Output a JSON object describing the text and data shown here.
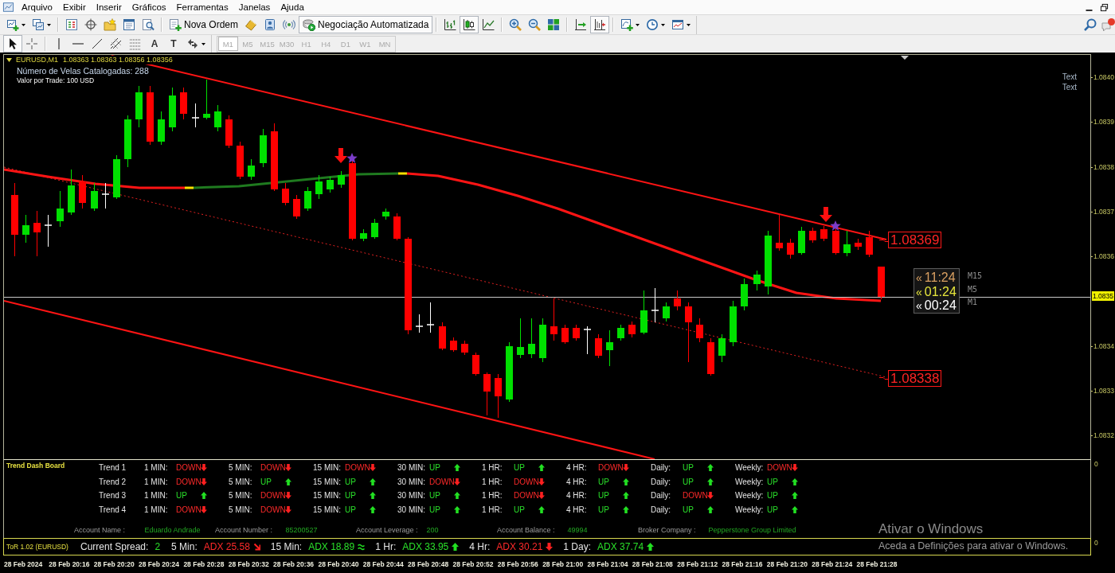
{
  "menu_bar": {
    "items": [
      "Arquivo",
      "Exibir",
      "Inserir",
      "Gráficos",
      "Ferramentas",
      "Janelas",
      "Ajuda"
    ]
  },
  "toolbar": {
    "new_order": "Nova Ordem",
    "auto_trading": {
      "label": "Negociação Automatizada",
      "on": true
    },
    "chart_types": [
      {
        "selected": false
      },
      {
        "selected": true
      },
      {
        "selected": false
      }
    ],
    "chart_shift": {
      "on": true
    }
  },
  "drawing_tools": [
    {
      "selected": true
    },
    {
      "selected": false
    },
    {
      "selected": false
    },
    {
      "selected": false
    },
    {
      "selected": false
    },
    {
      "selected": false
    },
    {
      "selected": false
    },
    {
      "selected": false,
      "glyph": "A"
    },
    {
      "selected": false,
      "glyph": "T"
    }
  ],
  "timeframes": [
    {
      "label": "M1",
      "selected": true,
      "disabled": true
    },
    {
      "label": "M5",
      "selected": false,
      "disabled": true
    },
    {
      "label": "M15",
      "selected": false,
      "disabled": true
    },
    {
      "label": "M30",
      "selected": false,
      "disabled": true
    },
    {
      "label": "H1",
      "selected": false,
      "disabled": true
    },
    {
      "label": "H4",
      "selected": false,
      "disabled": true
    },
    {
      "label": "D1",
      "selected": false,
      "disabled": true
    },
    {
      "label": "W1",
      "selected": false,
      "disabled": true
    },
    {
      "label": "MN",
      "selected": false,
      "disabled": true
    }
  ],
  "chart": {
    "symbol": "EURUSD,M1",
    "ohlc": "1.08363 1.08363 1.08356 1.08356",
    "info": [
      "Número de Velas Catalogadas: 288",
      "Valor por Trade: 100 USD"
    ],
    "corner_texts": [
      "Text",
      "Text"
    ],
    "channel_labels": [
      "1.08369",
      "1.08338"
    ],
    "timers": [
      {
        "prefix": "«",
        "value": "11:24",
        "period": "M15",
        "color": "#d9a062"
      },
      {
        "prefix": "«",
        "value": "01:24",
        "period": "M5",
        "color": "#e6e63c"
      },
      {
        "prefix": "«",
        "value": "00:24",
        "period": "M1",
        "color": "#ffffff"
      }
    ],
    "price_axis": [
      "1.0840",
      "1.0839",
      "1.0838",
      "1.0837",
      "1.0836",
      "1.0834",
      "1.0833",
      "1.0832"
    ],
    "current_price": "1.0835"
  },
  "trend_dashboard": {
    "title": "Trend Dash Board",
    "rows": [
      {
        "label": "Trend 1",
        "cells": [
          {
            "timeframe": "1 MIN:",
            "value": "DOWN",
            "kind": "down"
          },
          {
            "timeframe": "5 MIN:",
            "value": "DOWN",
            "kind": "down"
          },
          {
            "timeframe": "15 MIN:",
            "value": "DOWN",
            "kind": "down"
          },
          {
            "timeframe": "30 MIN:",
            "value": "UP",
            "kind": "up"
          },
          {
            "timeframe": "1 HR:",
            "value": "UP",
            "kind": "up"
          },
          {
            "timeframe": "4 HR:",
            "value": "DOWN",
            "kind": "down"
          },
          {
            "timeframe": "Daily:",
            "value": "UP",
            "kind": "up"
          },
          {
            "timeframe": "Weekly:",
            "value": "DOWN",
            "kind": "down"
          }
        ]
      },
      {
        "label": "Trend 2",
        "cells": [
          {
            "timeframe": "1 MIN:",
            "value": "DOWN",
            "kind": "down"
          },
          {
            "timeframe": "5 MIN:",
            "value": "UP",
            "kind": "up"
          },
          {
            "timeframe": "15 MIN:",
            "value": "UP",
            "kind": "up"
          },
          {
            "timeframe": "30 MIN:",
            "value": "DOWN",
            "kind": "down"
          },
          {
            "timeframe": "1 HR:",
            "value": "DOWN",
            "kind": "down"
          },
          {
            "timeframe": "4 HR:",
            "value": "UP",
            "kind": "up"
          },
          {
            "timeframe": "Daily:",
            "value": "UP",
            "kind": "up"
          },
          {
            "timeframe": "Weekly:",
            "value": "UP",
            "kind": "up"
          }
        ]
      },
      {
        "label": "Trend 3",
        "cells": [
          {
            "timeframe": "1 MIN:",
            "value": "UP",
            "kind": "up"
          },
          {
            "timeframe": "5 MIN:",
            "value": "DOWN",
            "kind": "down"
          },
          {
            "timeframe": "15 MIN:",
            "value": "UP",
            "kind": "up"
          },
          {
            "timeframe": "30 MIN:",
            "value": "UP",
            "kind": "up"
          },
          {
            "timeframe": "1 HR:",
            "value": "DOWN",
            "kind": "down"
          },
          {
            "timeframe": "4 HR:",
            "value": "UP",
            "kind": "up"
          },
          {
            "timeframe": "Daily:",
            "value": "DOWN",
            "kind": "down"
          },
          {
            "timeframe": "Weekly:",
            "value": "UP",
            "kind": "up"
          }
        ]
      },
      {
        "label": "Trend 4",
        "cells": [
          {
            "timeframe": "1 MIN:",
            "value": "DOWN",
            "kind": "down"
          },
          {
            "timeframe": "5 MIN:",
            "value": "DOWN",
            "kind": "down"
          },
          {
            "timeframe": "15 MIN:",
            "value": "UP",
            "kind": "up"
          },
          {
            "timeframe": "30 MIN:",
            "value": "UP",
            "kind": "up"
          },
          {
            "timeframe": "1 HR:",
            "value": "UP",
            "kind": "up"
          },
          {
            "timeframe": "4 HR:",
            "value": "UP",
            "kind": "up"
          },
          {
            "timeframe": "Daily:",
            "value": "UP",
            "kind": "up"
          },
          {
            "timeframe": "Weekly:",
            "value": "UP",
            "kind": "up"
          }
        ]
      }
    ],
    "account": [
      {
        "label": "Account Name :",
        "value": "Eduardo Andrade"
      },
      {
        "label": "Account Number :",
        "value": "85200527"
      },
      {
        "label": "Account Leverage :",
        "value": "200"
      },
      {
        "label": "Account Balance :",
        "value": "49994"
      },
      {
        "label": "Broker Company :",
        "value": "Pepperstone Group Limited"
      }
    ],
    "axis_label": "0"
  },
  "tor_bar": {
    "title": "ToR 1.02 (EURUSD)",
    "spread_label": "Current Spread:",
    "spread": "2",
    "items": [
      {
        "label": "5 Min:",
        "value": "ADX 25.58",
        "kind": "falling"
      },
      {
        "label": "15 Min:",
        "value": "ADX 18.89",
        "kind": "flat"
      },
      {
        "label": "1 Hr:",
        "value": "ADX 33.95",
        "kind": "up"
      },
      {
        "label": "4 Hr:",
        "value": "ADX 30.21",
        "kind": "down"
      },
      {
        "label": "1 Day:",
        "value": "ADX 37.74",
        "kind": "up"
      }
    ],
    "axis_label": "0"
  },
  "time_axis": [
    "28 Feb 2024",
    "28 Feb 20:16",
    "28 Feb 20:20",
    "28 Feb 20:24",
    "28 Feb 20:28",
    "28 Feb 20:32",
    "28 Feb 20:36",
    "28 Feb 20:40",
    "28 Feb 20:44",
    "28 Feb 20:48",
    "28 Feb 20:52",
    "28 Feb 20:56",
    "28 Feb 21:00",
    "28 Feb 21:04",
    "28 Feb 21:08",
    "28 Feb 21:12",
    "28 Feb 21:16",
    "28 Feb 21:20",
    "28 Feb 21:24",
    "28 Feb 21:28"
  ],
  "os_notice": {
    "title": "Ativar o Windows",
    "message": "Aceda a Definições para ativar o Windows."
  }
}
